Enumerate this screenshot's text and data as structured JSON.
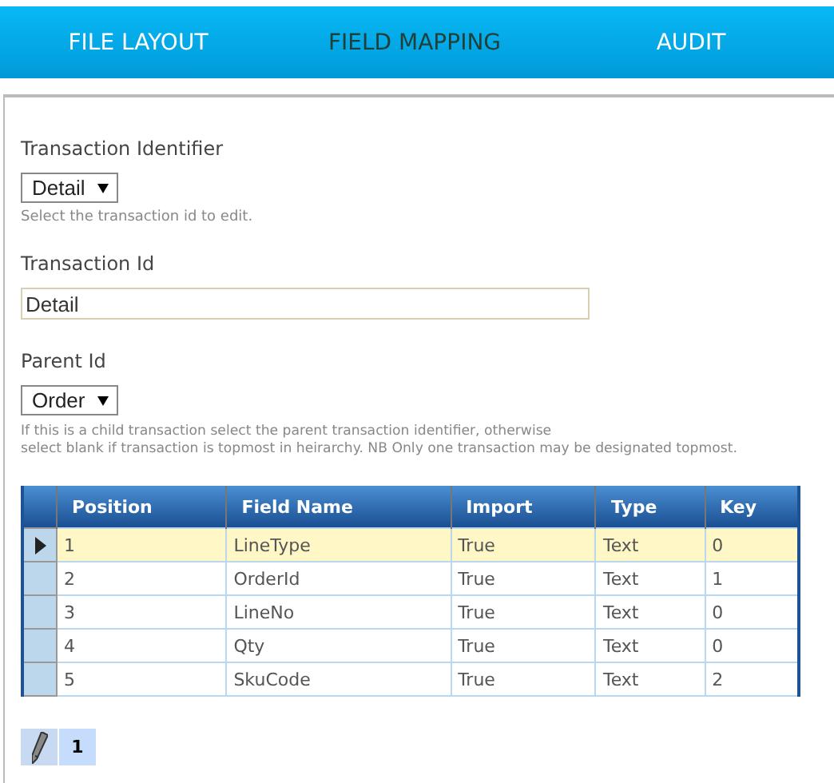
{
  "tabs": [
    {
      "label": "FILE LAYOUT",
      "selected": false
    },
    {
      "label": "FIELD MAPPING",
      "selected": true
    },
    {
      "label": "AUDIT",
      "selected": false
    }
  ],
  "form": {
    "transaction_identifier": {
      "label": "Transaction Identifier",
      "value": "Detail",
      "hint": "Select the transaction id to edit."
    },
    "transaction_id": {
      "label": "Transaction Id",
      "value": "Detail"
    },
    "parent_id": {
      "label": "Parent Id",
      "value": "Order",
      "hint_lines": [
        "If this is a child transaction select the parent transaction identifier, otherwise",
        "select blank if transaction is topmost in heirarchy. NB Only one transaction may be designated topmost."
      ]
    }
  },
  "table": {
    "columns": [
      "Position",
      "Field Name",
      "Import",
      "Type",
      "Key"
    ],
    "rows": [
      {
        "cells": [
          "1",
          "LineType",
          "True",
          "Text",
          "0"
        ],
        "selected": true
      },
      {
        "cells": [
          "2",
          "OrderId",
          "True",
          "Text",
          "1"
        ],
        "selected": false
      },
      {
        "cells": [
          "3",
          "LineNo",
          "True",
          "Text",
          "0"
        ],
        "selected": false
      },
      {
        "cells": [
          "4",
          "Qty",
          "True",
          "Text",
          "0"
        ],
        "selected": false
      },
      {
        "cells": [
          "5",
          "SkuCode",
          "True",
          "Text",
          "2"
        ],
        "selected": false
      }
    ]
  },
  "pager": {
    "pages": [
      {
        "label": "1",
        "selected": true
      }
    ]
  }
}
